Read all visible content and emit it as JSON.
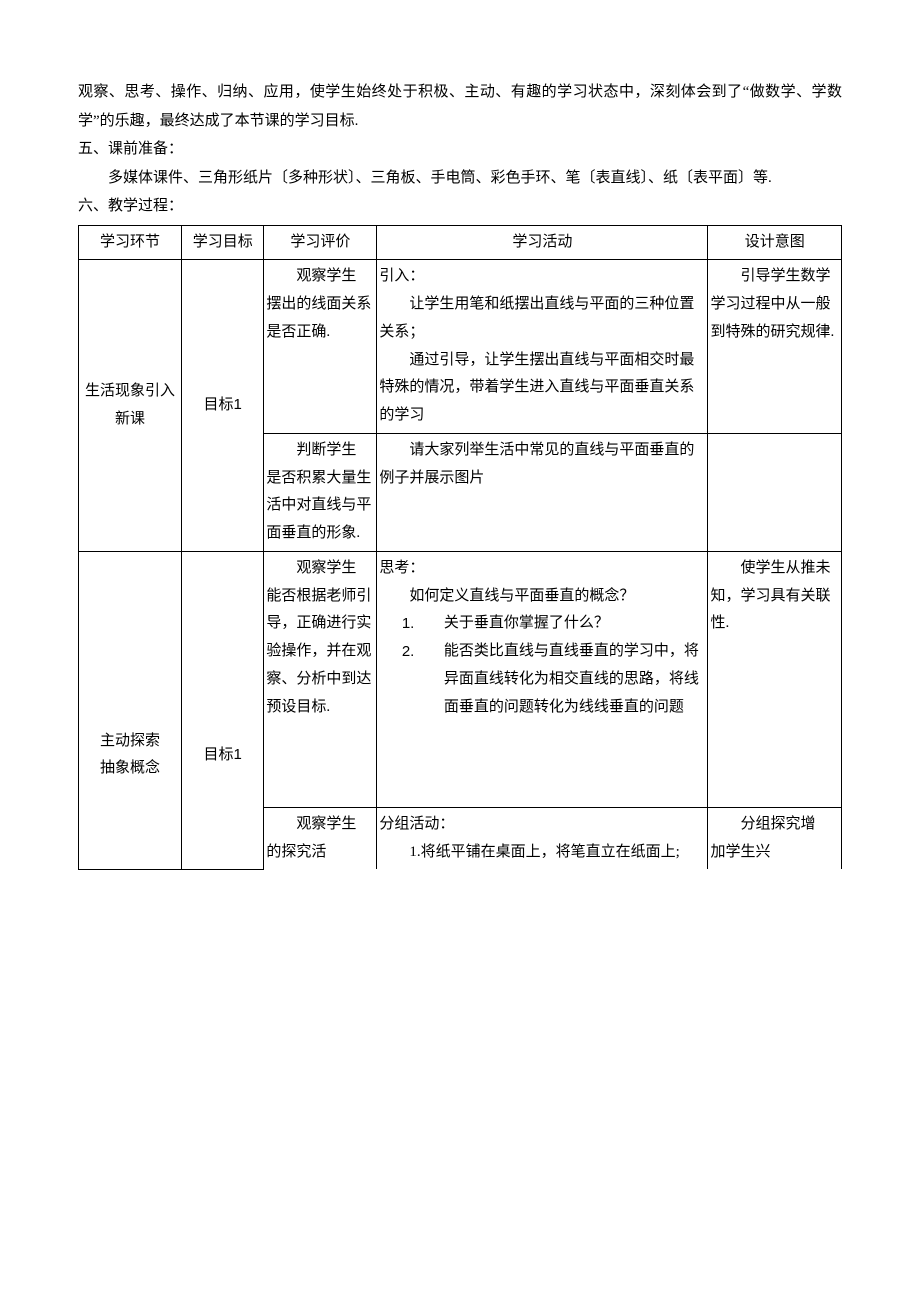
{
  "intro": {
    "para1": "观察、思考、操作、归纳、应用，使学生始终处于积极、主动、有趣的学习状态中，深刻体会到了“做数学、学数学”的乐趣，最终达成了本节课的学习目标.",
    "heading5": "五、课前准备：",
    "prep": "多媒体课件、三角形纸片〔多种形状〕、三角板、手电筒、彩色手环、笔〔表直线〕、纸〔表平面〕等.",
    "heading6": "六、教学过程："
  },
  "table": {
    "headers": {
      "c1": "学习环节",
      "c2": "学习目标",
      "c3": "学习评价",
      "c4": "学习活动",
      "c5": "设计意图"
    },
    "row1": {
      "phase_l1": "生活现象引入",
      "phase_l2": "新课",
      "goal": "目标1",
      "eval1_first": "观察学生",
      "eval1_rest": "摆出的线面关系是否正确.",
      "act1_lead": "引入：",
      "act1_p1": "让学生用笔和纸摆出直线与平面的三种位置关系；",
      "act1_p2": "通过引导，让学生摆出直线与平面相交时最特殊的情况，带着学生进入直线与平面垂直关系的学习",
      "intent1": "引导学生数学学习过程中从一般到特殊的研究规律.",
      "eval2_first": "判断学生",
      "eval2_rest": "是否积累大量生活中对直线与平面垂直的形象.",
      "act2_p1": "请大家列举生活中常见的直线与平面垂直的例子并展示图片"
    },
    "row2": {
      "phase_l1": "主动探索",
      "phase_l2": "抽象概念",
      "goal": "目标1",
      "eval1_first": "观察学生",
      "eval1_rest": "能否根据老师引导，正确进行实验操作，并在观察、分析中到达预设目标.",
      "act1_lead": "思考：",
      "act1_p1": "如何定义直线与平面垂直的概念？",
      "act1_li1_num": "1.",
      "act1_li1": "关于垂直你掌握了什么？",
      "act1_li2_num": "2.",
      "act1_li2": "能否类比直线与直线垂直的学习中，将异面直线转化为相交直线的思路，将线面垂直的问题转化为线线垂直的问题",
      "intent1": "使学生从推未知，学习具有关联性.",
      "eval2_first": "观察学生",
      "eval2_rest": "的探究活",
      "act2_lead": "分组活动：",
      "act2_p1": "1.将纸平铺在桌面上，将笔直立在纸面上;",
      "intent2": "分组探究增",
      "intent2b": "加学生兴"
    }
  }
}
